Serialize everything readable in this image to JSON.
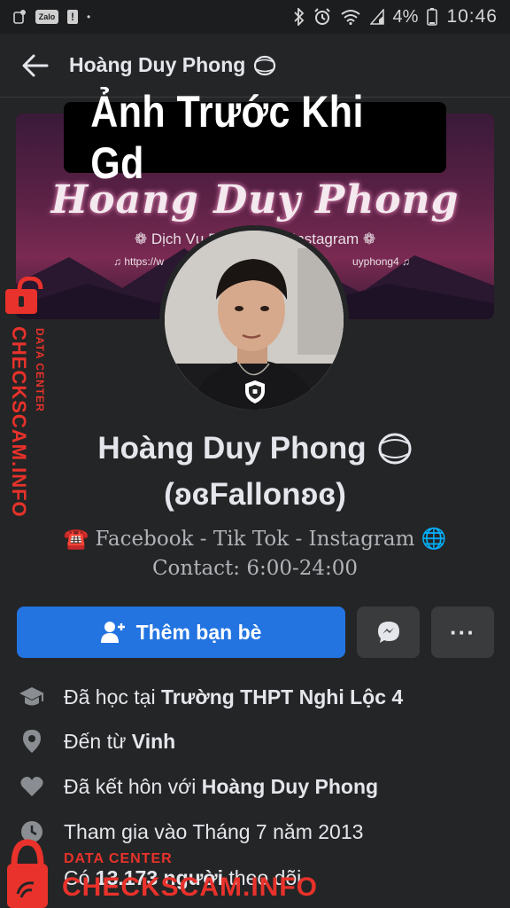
{
  "status_bar": {
    "zalo_label": "Zalo",
    "alert_label": "!",
    "dot": "•",
    "battery": "4%",
    "time": "10:46"
  },
  "header": {
    "title": "Hoàng Duy Phong"
  },
  "overlay": {
    "banner_text": "Ảnh Trước Khi Gd"
  },
  "cover": {
    "script_name": "Hoang Duy Phong",
    "subtitle": "❁ Dịch Vụ Facebo      ok - Instagram ❁",
    "link_left": "♫ https://w",
    "link_right": "uyphong4 ♫"
  },
  "profile": {
    "name": "Hoàng Duy Phong",
    "alt_name": "(ʚɞFallonʚɞ)",
    "bio_line1": "☎️ Facebook - Tik Tok - Instagram 🌐",
    "bio_line2": "Contact: 6:00-24:00"
  },
  "actions": {
    "add_friend_label": "Thêm bạn bè",
    "more_label": "···"
  },
  "info": {
    "education_prefix": "Đã học tại ",
    "education_value": "Trường THPT Nghi Lộc 4",
    "from_prefix": "Đến từ ",
    "from_value": "Vinh",
    "married_prefix": "Đã kết hôn với ",
    "married_value": "Hoàng Duy Phong",
    "joined_text": "Tham gia vào Tháng 7 năm 2013",
    "followers_prefix": "Có ",
    "followers_value": "13.173 người",
    "followers_suffix": " theo dõi"
  },
  "watermark": {
    "vertical_big": "CHECKSCAM.INFO",
    "vertical_small": "DATA CENTER",
    "bottom_small": "DATA CENTER",
    "bottom_big": "CHECKSCAM.INFO"
  },
  "colors": {
    "accent": "#2374e1",
    "watermark_red": "#e8322b",
    "background": "#242526"
  }
}
